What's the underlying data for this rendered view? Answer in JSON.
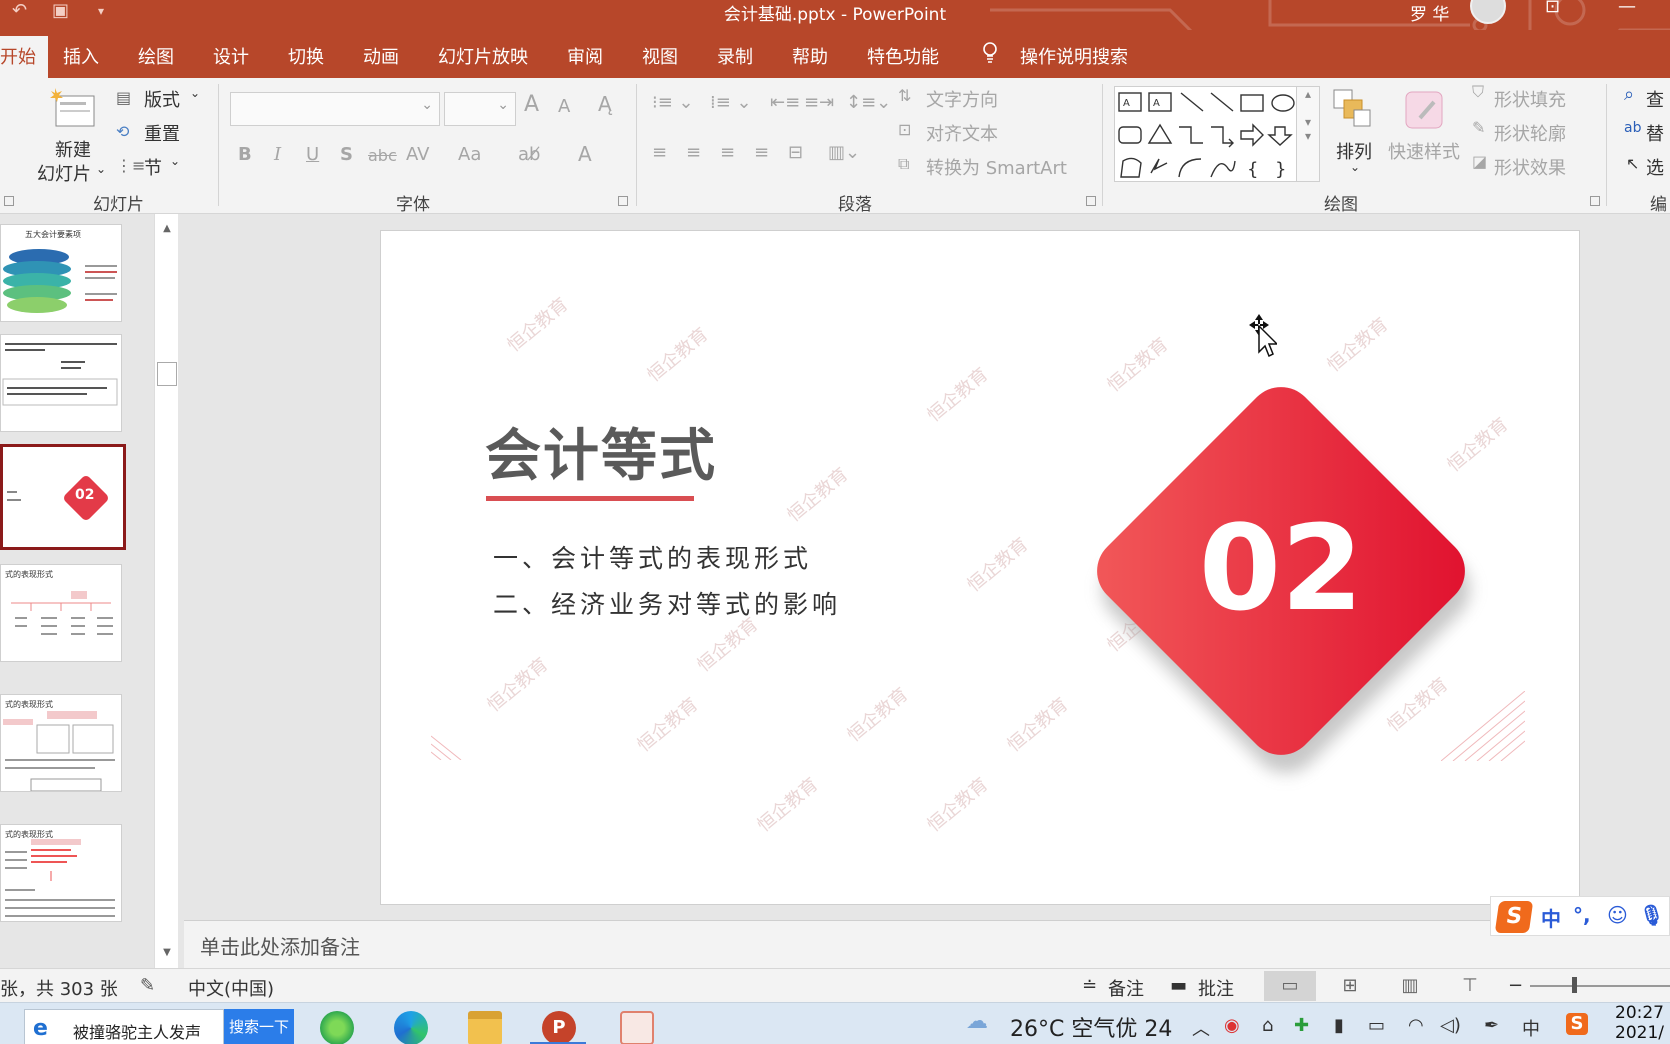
{
  "window": {
    "title": "会计基础.pptx  -  PowerPoint",
    "user": "罗 华"
  },
  "tabs": [
    {
      "label": "开始",
      "active": true
    },
    {
      "label": "插入"
    },
    {
      "label": "绘图"
    },
    {
      "label": "设计"
    },
    {
      "label": "切换"
    },
    {
      "label": "动画"
    },
    {
      "label": "幻灯片放映"
    },
    {
      "label": "审阅"
    },
    {
      "label": "视图"
    },
    {
      "label": "录制"
    },
    {
      "label": "帮助"
    },
    {
      "label": "特色功能"
    },
    {
      "label": "操作说明搜索"
    }
  ],
  "ribbon": {
    "slides_group": {
      "new_slide_line1": "新建",
      "new_slide_line2": "幻灯片",
      "layout": "版式",
      "reset": "重置",
      "section": "节",
      "label": "幻灯片"
    },
    "font_group": {
      "grow": "A",
      "shrink": "A",
      "bold": "B",
      "italic": "I",
      "underline": "U",
      "shadow": "S",
      "strike": "abc",
      "spacing": "AV",
      "case": "Aa",
      "color": "A",
      "label": "字体"
    },
    "paragraph_group": {
      "text_direction": "文字方向",
      "align_text": "对齐文本",
      "smartart": "转换为 SmartArt",
      "label": "段落"
    },
    "drawing_group": {
      "arrange": "排列",
      "quick_styles": "快速样式",
      "shape_fill": "形状填充",
      "shape_outline": "形状轮廓",
      "shape_effects": "形状效果",
      "label": "绘图"
    },
    "editing_group": {
      "find": "查",
      "replace": "替",
      "select": "选",
      "label": "编"
    }
  },
  "thumbnails": [
    {
      "title": "五大会计要素项"
    },
    {
      "title": ""
    },
    {
      "title": "02"
    },
    {
      "title": "式的表现形式"
    },
    {
      "title": "式的表现形式"
    },
    {
      "title": "式的表现形式"
    }
  ],
  "slide": {
    "title": "会计等式",
    "bullets": [
      "一、会计等式的表现形式",
      "二、经济业务对等式的影响"
    ],
    "badge_number": "02",
    "watermark": "恒企教育"
  },
  "notes": {
    "placeholder": "单击此处添加备注"
  },
  "ime": {
    "logo": "S",
    "mode": "中",
    "punct": "°,"
  },
  "status": {
    "slide_count": "张，共 303 张",
    "language": "中文(中国)",
    "notes_btn": "备注",
    "comments_btn": "批注"
  },
  "taskbar": {
    "search_text": "被撞骆驼主人发声",
    "search_button": "搜索一下",
    "weather": "26°C  空气优 24",
    "ime_indicator": "中",
    "time": "20:27",
    "date": "2021/"
  },
  "colors": {
    "accent": "#b7472a",
    "badge_start": "#f25a5a",
    "badge_end": "#e0102e",
    "underline": "#d94e52"
  }
}
